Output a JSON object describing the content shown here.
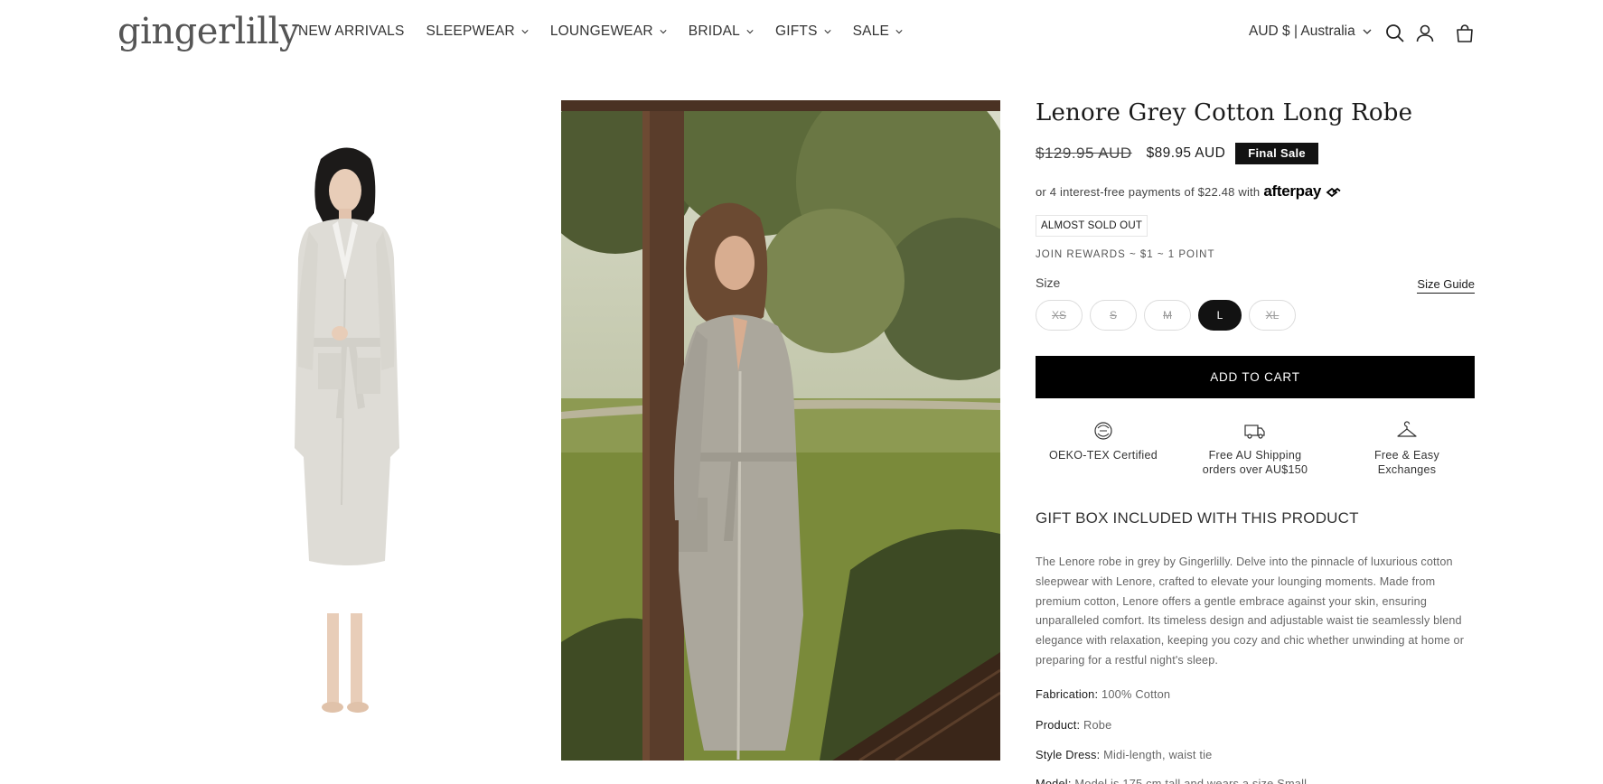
{
  "header": {
    "logo": "gingerlilly",
    "nav": [
      {
        "label": "NEW ARRIVALS",
        "dropdown": false
      },
      {
        "label": "SLEEPWEAR",
        "dropdown": true
      },
      {
        "label": "LOUNGEWEAR",
        "dropdown": true
      },
      {
        "label": "BRIDAL",
        "dropdown": true
      },
      {
        "label": "GIFTS",
        "dropdown": true
      },
      {
        "label": "SALE",
        "dropdown": true
      }
    ],
    "currency": "AUD $ | Australia",
    "icons": [
      "search-icon",
      "account-icon",
      "cart-icon"
    ]
  },
  "product": {
    "title": "Lenore Grey Cotton Long Robe",
    "price_old": "$129.95 AUD",
    "price_new": "$89.95 AUD",
    "badge": "Final Sale",
    "afterpay_text": "or 4 interest-free payments of $22.48 with",
    "afterpay_logo": "afterpay",
    "stock_badge": "ALMOST SOLD OUT",
    "rewards": "JOIN REWARDS ~ $1 ~ 1 POINT",
    "size_label": "Size",
    "size_guide": "Size Guide",
    "sizes": [
      {
        "label": "XS",
        "available": false,
        "selected": false
      },
      {
        "label": "S",
        "available": false,
        "selected": false
      },
      {
        "label": "M",
        "available": false,
        "selected": false
      },
      {
        "label": "L",
        "available": true,
        "selected": true
      },
      {
        "label": "XL",
        "available": false,
        "selected": false
      }
    ],
    "add_to_cart": "ADD TO CART",
    "features": [
      {
        "icon": "oeko-tex-icon",
        "line1": "OEKO-TEX Certified",
        "line2": ""
      },
      {
        "icon": "truck-icon",
        "line1": "Free AU Shipping",
        "line2": "orders over AU$150"
      },
      {
        "icon": "hanger-icon",
        "line1": "Free & Easy",
        "line2": "Exchanges"
      }
    ],
    "gift_box": "GIFT BOX INCLUDED WITH THIS PRODUCT",
    "description": "The Lenore robe in grey by Gingerlilly. Delve into the pinnacle of luxurious cotton sleepwear with Lenore, crafted to elevate your lounging moments. Made from premium cotton, Lenore offers a gentle embrace against your skin, ensuring unparalleled comfort. Its timeless design and adjustable waist tie seamlessly blend elegance with relaxation, keeping you cozy and chic whether unwinding at home or preparing for a restful night's sleep.",
    "specs": [
      {
        "key": "Fabrication:",
        "value": "100% Cotton"
      },
      {
        "key": "Product:",
        "value": "Robe"
      },
      {
        "key": "Style Dress:",
        "value": "Midi-length, waist tie"
      },
      {
        "key": "Model:",
        "value": "Model is 175 cm tall and wears a size Small"
      }
    ]
  },
  "colors": {
    "accent": "#121212",
    "text": "#1a1a1a",
    "muted": "#666666"
  }
}
